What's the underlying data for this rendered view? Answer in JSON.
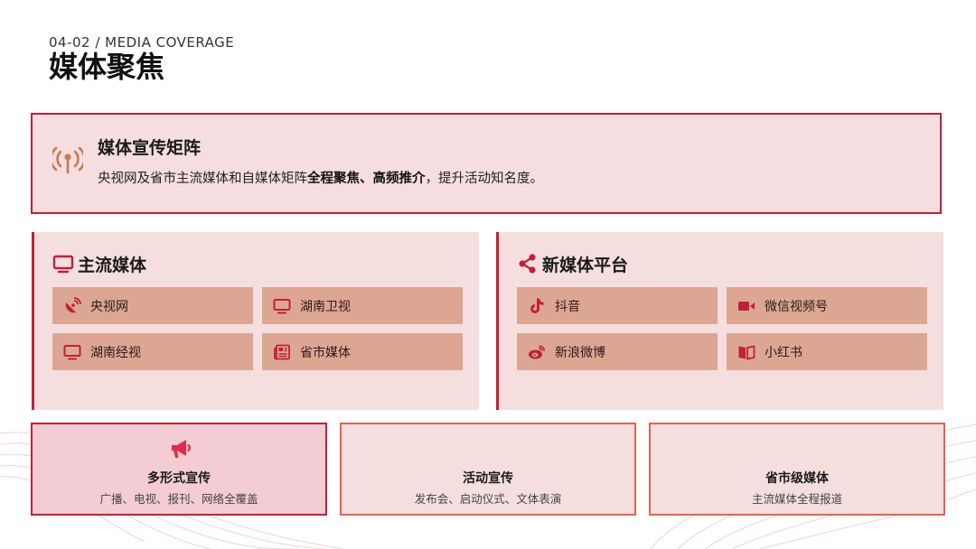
{
  "header": {
    "subtitle": "04-02 / MEDIA COVERAGE",
    "title": "媒体聚焦"
  },
  "hero": {
    "heading": "媒体宣传矩阵",
    "text_pre": "央视网及省市主流媒体和自媒体矩阵",
    "text_bold": "全程聚焦、高频推介",
    "text_post": "，提升活动知名度。",
    "icon": "broadcast-antenna-icon"
  },
  "mainstream": {
    "title": "主流媒体",
    "icon": "monitor-icon",
    "items": [
      {
        "label": "央视网",
        "icon": "satellite-dish-icon"
      },
      {
        "label": "湖南卫视",
        "icon": "monitor-icon"
      },
      {
        "label": "湖南经视",
        "icon": "monitor-icon"
      },
      {
        "label": "省市媒体",
        "icon": "newspaper-icon"
      }
    ]
  },
  "newmedia": {
    "title": "新媒体平台",
    "icon": "share-icon",
    "items": [
      {
        "label": "抖音",
        "icon": "tiktok-icon"
      },
      {
        "label": "微信视频号",
        "icon": "video-camera-icon"
      },
      {
        "label": "新浪微博",
        "icon": "weibo-icon"
      },
      {
        "label": "小红书",
        "icon": "book-icon"
      }
    ]
  },
  "cards": [
    {
      "title": "多形式宣传",
      "subtitle": "广播、电视、报刊、网络全覆盖",
      "icon": "megaphone-icon"
    },
    {
      "title": "活动宣传",
      "subtitle": "发布会、启动仪式、文体表演"
    },
    {
      "title": "省市级媒体",
      "subtitle": "主流媒体全程报道"
    }
  ],
  "colors": {
    "accent": "#c0203a",
    "chip": "#dda693",
    "panel": "#f5dede",
    "icon_orange": "#c77a52"
  }
}
